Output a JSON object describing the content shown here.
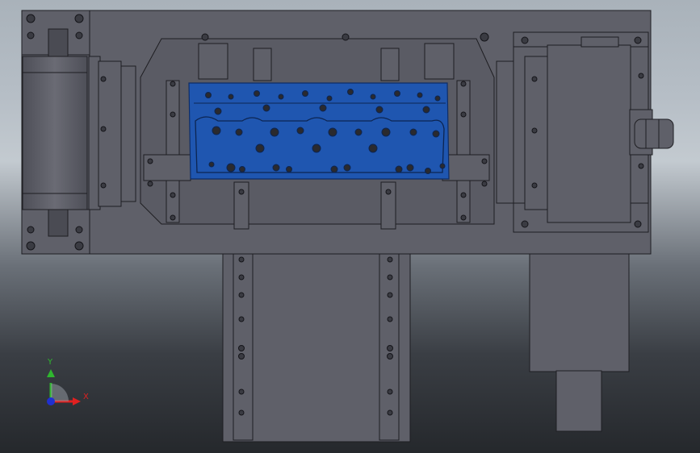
{
  "viewport": {
    "background_top": "#b6bec6",
    "background_bottom": "#25282c"
  },
  "model": {
    "part_color": "#5f6069",
    "edge_color": "#1e1e22",
    "cylinder_head_color": "#1f56b0",
    "hole_color": "#2a2a2e"
  },
  "triad": {
    "y_label": "Y",
    "x_label": "X",
    "y_color": "#2fb62f",
    "x_color": "#e02020",
    "z_color": "#2030d0"
  }
}
